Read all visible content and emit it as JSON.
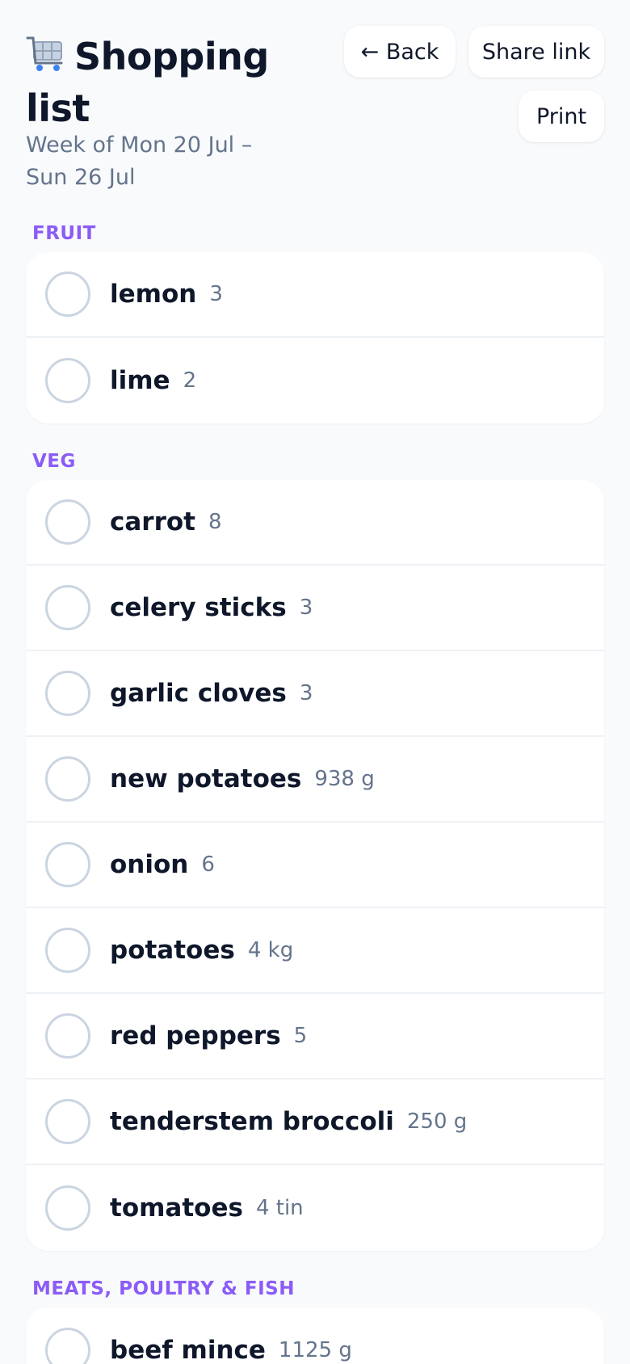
{
  "header": {
    "title": "Shopping list",
    "title_icon": "shopping-cart-icon",
    "subtitle": "Week of Mon 20 Jul – Sun 26 Jul"
  },
  "actions": {
    "back_label": "← Back",
    "share_label": "Share link",
    "print_label": "Print"
  },
  "colors": {
    "accent": "#8b5cf6",
    "text": "#0f172a",
    "muted": "#64748b",
    "background": "#f8fafc"
  },
  "sections": [
    {
      "label": "FRUIT",
      "items": [
        {
          "name": "lemon",
          "qty": "3"
        },
        {
          "name": "lime",
          "qty": "2"
        }
      ]
    },
    {
      "label": "VEG",
      "items": [
        {
          "name": "carrot",
          "qty": "8"
        },
        {
          "name": "celery sticks",
          "qty": "3"
        },
        {
          "name": "garlic cloves",
          "qty": "3"
        },
        {
          "name": "new potatoes",
          "qty": "938 g"
        },
        {
          "name": "onion",
          "qty": "6"
        },
        {
          "name": "potatoes",
          "qty": "4 kg"
        },
        {
          "name": "red peppers",
          "qty": "5"
        },
        {
          "name": "tenderstem broccoli",
          "qty": "250 g"
        },
        {
          "name": "tomatoes",
          "qty": "4 tin"
        }
      ]
    },
    {
      "label": "MEATS, POULTRY & FISH",
      "items": [
        {
          "name": "beef mince",
          "qty": "1125 g"
        }
      ]
    }
  ]
}
